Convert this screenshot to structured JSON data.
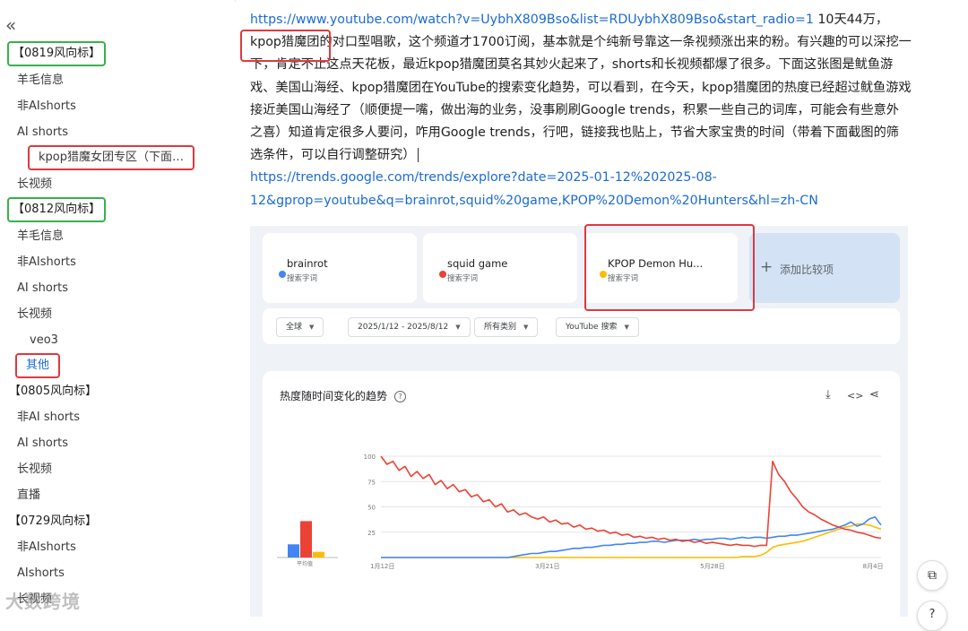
{
  "sidebar": {
    "collapse_icon": "«",
    "items": [
      {
        "label": "【0819风向标】",
        "kind": "group",
        "box": "green"
      },
      {
        "label": "羊毛信息",
        "kind": "item"
      },
      {
        "label": "非AIshorts",
        "kind": "item"
      },
      {
        "label": "AI shorts",
        "kind": "item"
      },
      {
        "label": "kpop猎魔女团专区（下面…",
        "kind": "sub",
        "box": "red"
      },
      {
        "label": "长视频",
        "kind": "item"
      },
      {
        "label": "【0812风向标】",
        "kind": "group",
        "box": "green"
      },
      {
        "label": "羊毛信息",
        "kind": "item"
      },
      {
        "label": "非AIshorts",
        "kind": "item"
      },
      {
        "label": "AI shorts",
        "kind": "item"
      },
      {
        "label": "长视频",
        "kind": "item"
      },
      {
        "label": "veo3",
        "kind": "sub"
      },
      {
        "label": "其他",
        "kind": "sub",
        "box": "red",
        "active": true
      },
      {
        "label": "【0805风向标】",
        "kind": "group"
      },
      {
        "label": "非AI shorts",
        "kind": "item"
      },
      {
        "label": "AI shorts",
        "kind": "item"
      },
      {
        "label": "长视频",
        "kind": "item"
      },
      {
        "label": "直播",
        "kind": "item"
      },
      {
        "label": "【0729风向标】",
        "kind": "group"
      },
      {
        "label": "非AIshorts",
        "kind": "item"
      },
      {
        "label": "AIshorts",
        "kind": "item"
      },
      {
        "label": "长视频",
        "kind": "item"
      }
    ],
    "watermark": "大数跨境"
  },
  "article": {
    "link1": "https://www.youtube.com/watch?v=UybhX809Bso&list=RDUybhX809Bso&start_radio=1",
    "text1": " 10天44万，kpop猎魔团的对口型唱歌，这个频道才1700订阅，基本就是个纯新号靠这一条视频涨出来的粉。有兴趣的可以深挖一下，肯定不止这点天花板，最近kpop猎魔团莫名其妙火起来了，shorts和长视频都爆了很多。下面这张图是鱿鱼游戏、美国山海经、kpop猎魔团在YouTube的搜索变化趋势，可以看到，在今天，kpop猎魔团的热度已经超过鱿鱼游戏接近美国山海经了（顺便提一嘴，做出海的业务，没事刷刷Google trends，积累一些自己的词库，可能会有些意外之喜）知道肯定很多人要问，咋用Google trends，行吧，链接我也贴上，节省大家宝贵的时间（带着下面截图的筛选条件，可以自行调整研究）",
    "link2": "https://trends.google.com/trends/explore?date=2025-01-12%202025-08-12&gprop=youtube&q=brainrot,squid%20game,KPOP%20Demon%20Hunters&hl=zh-CN"
  },
  "trends": {
    "terms": [
      {
        "name": "brainrot",
        "sub": "搜索字词",
        "color": "#4285f4"
      },
      {
        "name": "squid game",
        "sub": "搜索字词",
        "color": "#ea4335"
      },
      {
        "name": "KPOP Demon Hu...",
        "sub": "搜索字词",
        "color": "#fbbc04"
      }
    ],
    "add_label": "添加比较项",
    "filters": [
      "全球",
      "2025/1/12 - 2025/8/12",
      "所有类别",
      "YouTube 搜索"
    ],
    "chart_title": "热度随时间变化的趋势",
    "tools": {
      "download": "⤓",
      "embed": "<>",
      "share": "⋖"
    }
  },
  "chart_data": {
    "type": "line",
    "title": "热度随时间变化的趋势",
    "ylim": [
      0,
      100
    ],
    "yticks": [
      "100",
      "75",
      "50",
      "25"
    ],
    "xticks": [
      "1月12日",
      "3月21日",
      "5月28日",
      "8月4日"
    ],
    "average_label": "平均值",
    "averages": [
      {
        "name": "brainrot",
        "value": 21
      },
      {
        "name": "squid game",
        "value": 58
      },
      {
        "name": "KPOP Demon Hunters",
        "value": 9
      }
    ],
    "series": [
      {
        "name": "squid game",
        "color": "#ea4335",
        "values": [
          100,
          92,
          95,
          86,
          90,
          80,
          85,
          78,
          82,
          72,
          76,
          68,
          72,
          65,
          67,
          60,
          62,
          55,
          57,
          50,
          53,
          45,
          47,
          42,
          44,
          40,
          38,
          40,
          35,
          37,
          33,
          34,
          30,
          32,
          28,
          29,
          26,
          27,
          24,
          25,
          22,
          23,
          20,
          21,
          19,
          20,
          18,
          19,
          17,
          18,
          16,
          17,
          15,
          16,
          14,
          15,
          14,
          13,
          12,
          13,
          12,
          12,
          11,
          12,
          12,
          95,
          82,
          75,
          65,
          58,
          50,
          45,
          42,
          38,
          35,
          32,
          30,
          28,
          27,
          25,
          24,
          22,
          20,
          19
        ]
      },
      {
        "name": "brainrot",
        "color": "#4285f4",
        "values": [
          0,
          0,
          0,
          0,
          0,
          0,
          0,
          0,
          0,
          0,
          0,
          0,
          0,
          0,
          0,
          0,
          0,
          0,
          0,
          0,
          0,
          0,
          1,
          2,
          3,
          4,
          4,
          5,
          6,
          6,
          7,
          8,
          9,
          9,
          10,
          10,
          11,
          12,
          12,
          13,
          13,
          14,
          14,
          15,
          15,
          16,
          16,
          15,
          16,
          17,
          17,
          17,
          18,
          17,
          18,
          18,
          19,
          19,
          18,
          19,
          20,
          19,
          20,
          20,
          19,
          20,
          21,
          21,
          22,
          22,
          23,
          24,
          25,
          26,
          27,
          28,
          30,
          32,
          35,
          31,
          33,
          38,
          40,
          32
        ]
      },
      {
        "name": "KPOP Demon Hunters",
        "color": "#fbbc04",
        "values": [
          0,
          0,
          0,
          0,
          0,
          0,
          0,
          0,
          0,
          0,
          0,
          0,
          0,
          0,
          0,
          0,
          0,
          0,
          0,
          0,
          0,
          0,
          0,
          0,
          0,
          0,
          0,
          0,
          0,
          0,
          0,
          0,
          0,
          0,
          0,
          0,
          0,
          0,
          0,
          0,
          0,
          0,
          0,
          0,
          0,
          0,
          0,
          0,
          0,
          0,
          0,
          0,
          0,
          0,
          0,
          0,
          0,
          0,
          0,
          0,
          1,
          1,
          1,
          2,
          5,
          10,
          12,
          13,
          14,
          15,
          16,
          18,
          20,
          22,
          24,
          26,
          28,
          30,
          31,
          33,
          33,
          32,
          30,
          28
        ]
      }
    ]
  }
}
